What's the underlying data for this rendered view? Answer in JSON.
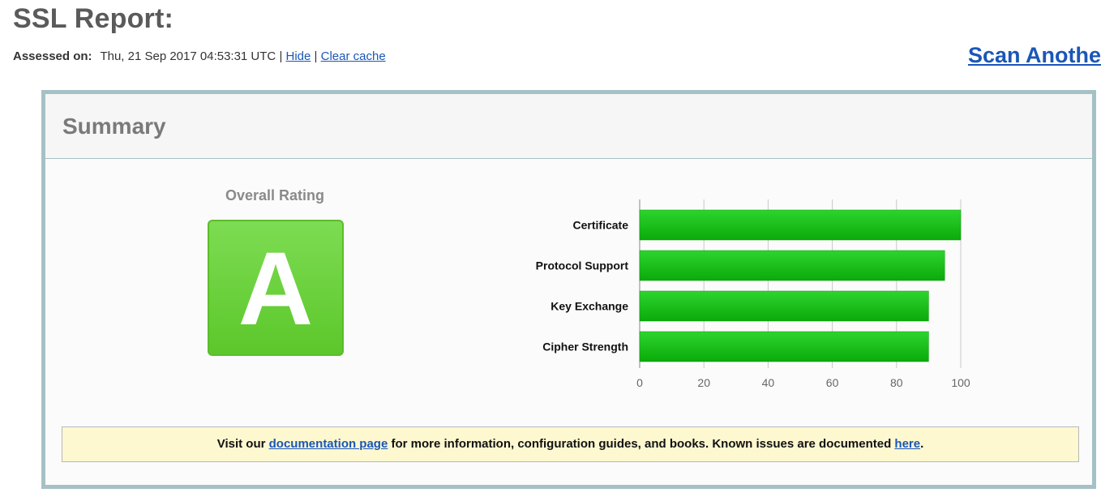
{
  "header": {
    "title": "SSL Report:",
    "assessed_label": "Assessed on:",
    "assessed_value": "Thu, 21 Sep 2017 04:53:31 UTC",
    "separator": "|",
    "hide_link": "Hide",
    "clear_cache_link": "Clear cache",
    "scan_another": "Scan Anothe"
  },
  "summary": {
    "title": "Summary",
    "overall_rating_label": "Overall Rating",
    "grade": "A",
    "grade_color": "#6cd13b"
  },
  "chart_data": {
    "type": "bar",
    "orientation": "horizontal",
    "categories": [
      "Certificate",
      "Protocol Support",
      "Key Exchange",
      "Cipher Strength"
    ],
    "values": [
      100,
      95,
      90,
      90
    ],
    "xlim": [
      0,
      100
    ],
    "xticks": [
      "0",
      "20",
      "40",
      "60",
      "80",
      "100"
    ],
    "grid": true,
    "bar_color": "#1cc41c"
  },
  "notice": {
    "prefix": "Visit our",
    "doc_link": "documentation page",
    "middle": "for more information, configuration guides, and books. Known issues are documented",
    "here_link": "here",
    "suffix": "."
  }
}
